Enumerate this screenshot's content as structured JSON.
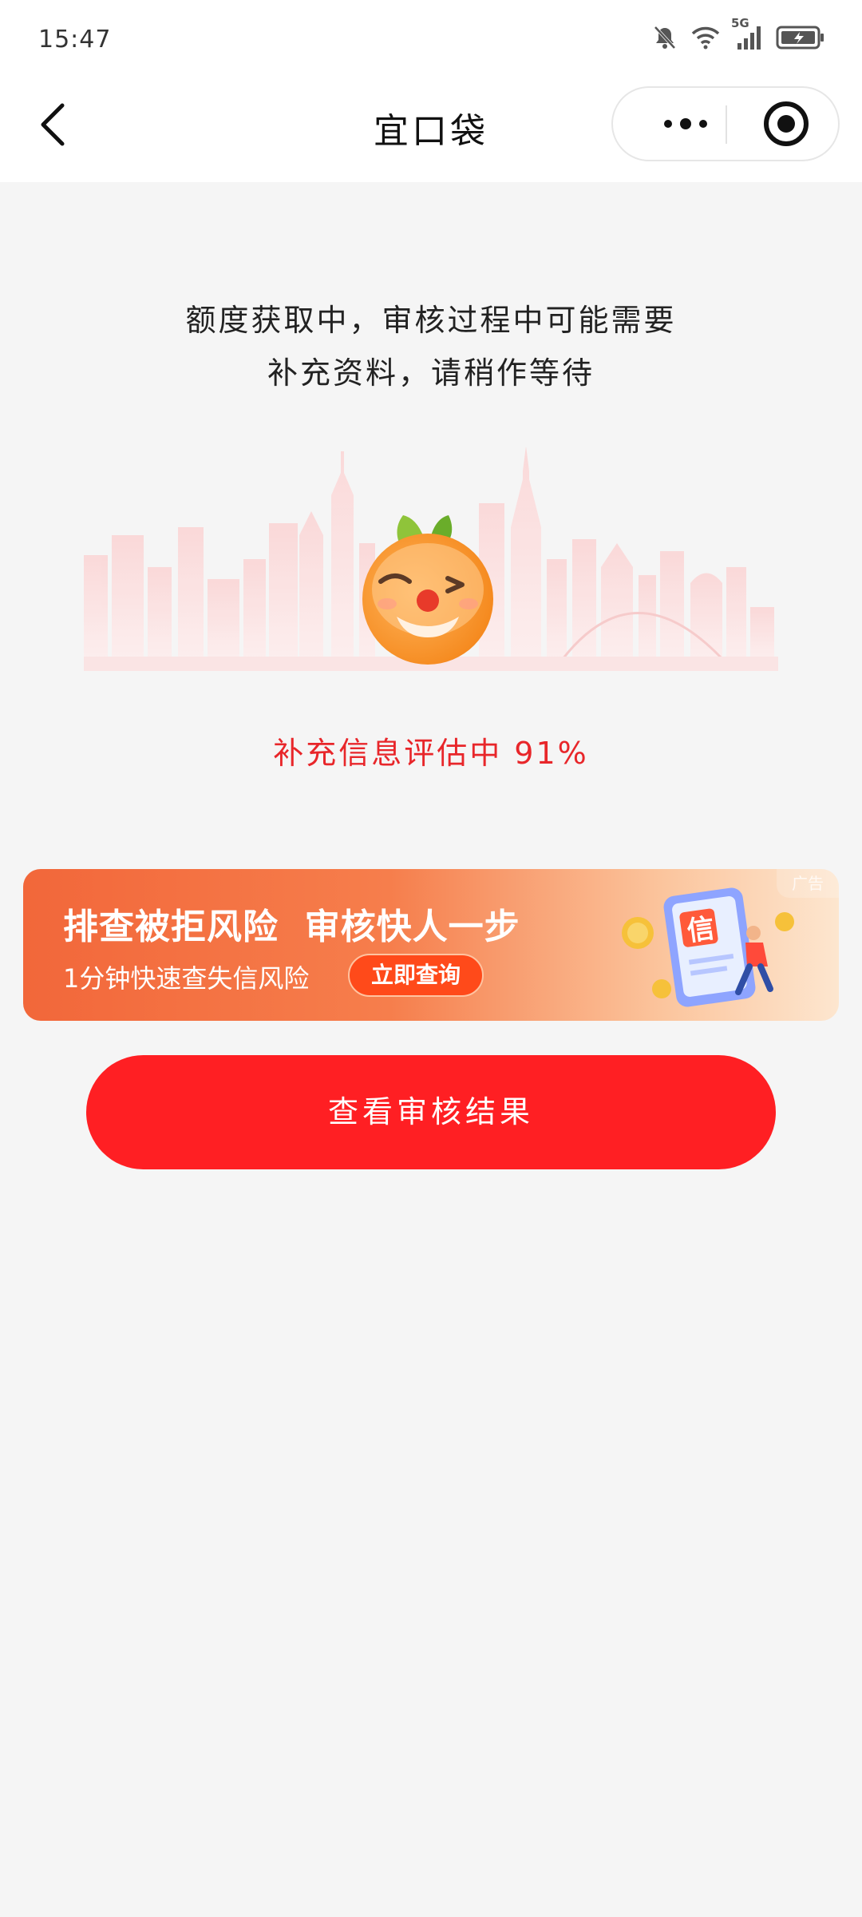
{
  "status_bar": {
    "time": "15:47",
    "network": "5G"
  },
  "header": {
    "title": "宜口袋",
    "back_icon": "chevron-left-icon",
    "more_icon": "more-dots-icon",
    "close_icon": "miniprogram-close-icon"
  },
  "main": {
    "message_line1": "额度获取中，审核过程中可能需要",
    "message_line2": "补充资料，请稍作等待",
    "progress_text": "补充信息评估中 91%",
    "progress_value": 91
  },
  "ad": {
    "tag": "广告",
    "title": "排查被拒风险  审核快人一步",
    "subtitle": "1分钟快速查失信风险",
    "button": "立即查询",
    "badge_char": "信"
  },
  "primary_button": {
    "label": "查看审核结果"
  },
  "colors": {
    "accent": "#ff1f23",
    "progress_text": "#e8262a",
    "background": "#f5f5f5"
  }
}
